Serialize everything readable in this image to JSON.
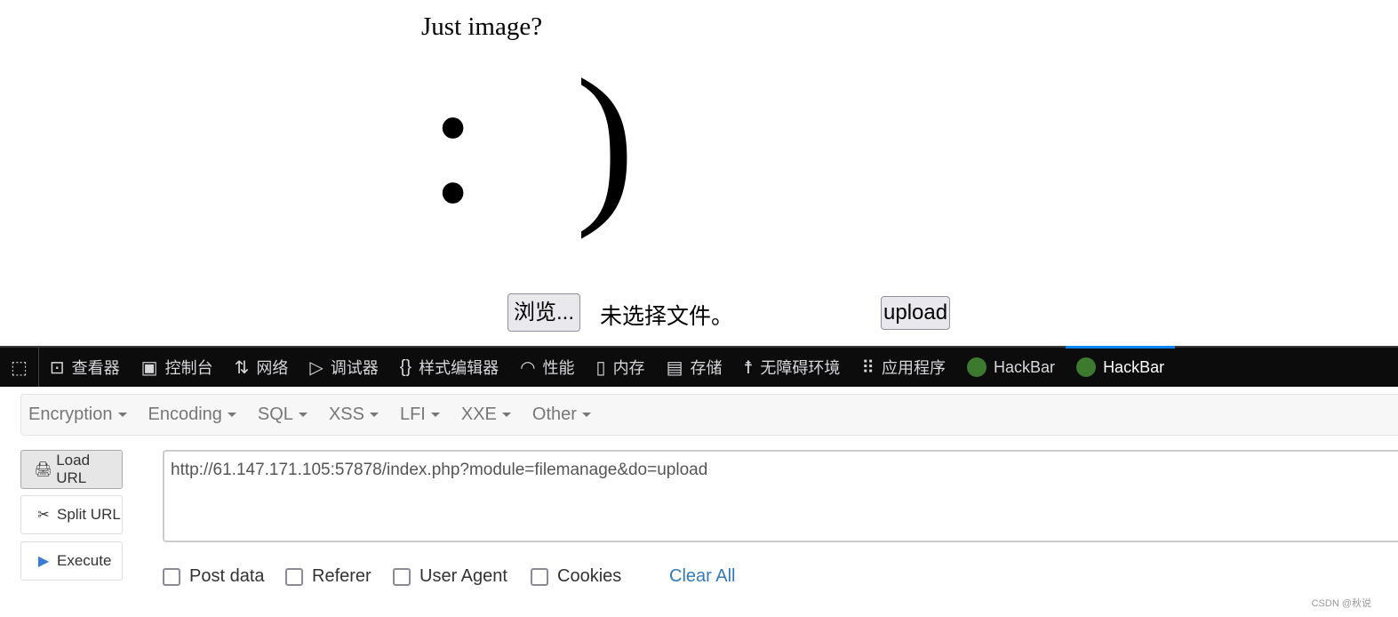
{
  "page": {
    "title": "Just image?",
    "smiley": ": )",
    "browse_label": "浏览...",
    "no_file": "未选择文件。",
    "upload_label": "upload"
  },
  "devtools": {
    "tabs": [
      {
        "label": "",
        "icon": "pick-element-icon"
      },
      {
        "label": "查看器",
        "icon": "inspector-icon"
      },
      {
        "label": "控制台",
        "icon": "console-icon"
      },
      {
        "label": "网络",
        "icon": "network-icon"
      },
      {
        "label": "调试器",
        "icon": "debugger-icon"
      },
      {
        "label": "样式编辑器",
        "icon": "braces-icon"
      },
      {
        "label": "性能",
        "icon": "gauge-icon"
      },
      {
        "label": "内存",
        "icon": "memory-icon"
      },
      {
        "label": "存储",
        "icon": "storage-icon"
      },
      {
        "label": "无障碍环境",
        "icon": "accessibility-icon"
      },
      {
        "label": "应用程序",
        "icon": "grid-icon"
      },
      {
        "label": "HackBar",
        "icon": "hackbar-icon"
      },
      {
        "label": "HackBar",
        "icon": "hackbar-icon",
        "active": true
      }
    ]
  },
  "hackbar": {
    "menu": [
      "Encryption",
      "Encoding",
      "SQL",
      "XSS",
      "LFI",
      "XXE",
      "Other"
    ],
    "load_url": "Load URL",
    "split_url": "Split URL",
    "execute": "Execute",
    "url": "http://61.147.171.105:57878/index.php?module=filemanage&do=upload",
    "checkboxes": [
      "Post data",
      "Referer",
      "User Agent",
      "Cookies"
    ],
    "clear_all": "Clear All"
  },
  "watermark": "CSDN @秋说"
}
